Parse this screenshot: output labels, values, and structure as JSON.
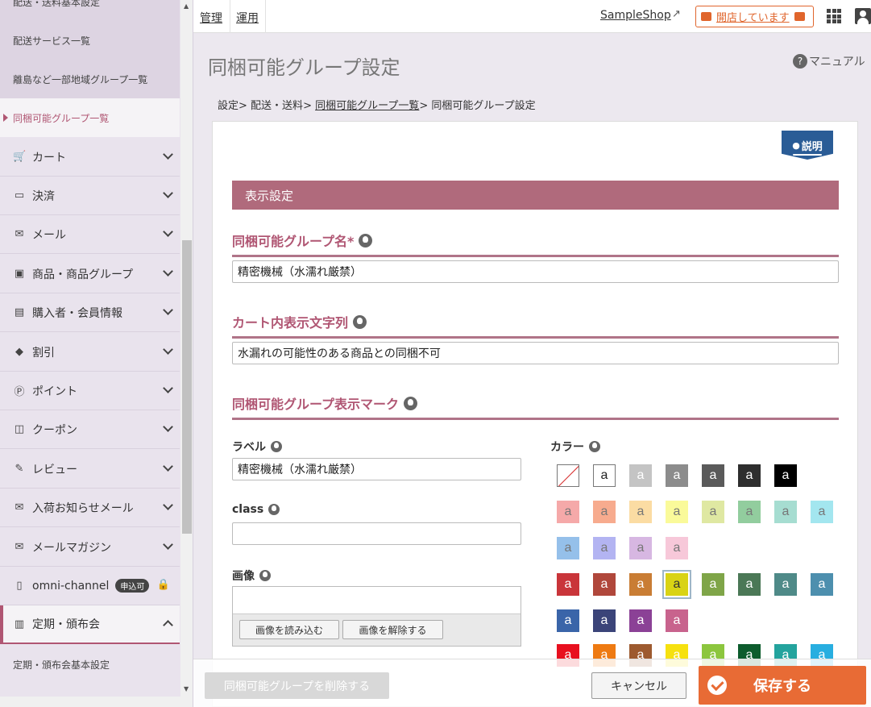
{
  "sidebar": {
    "sub_items_top": [
      {
        "label": "配送・送料基本設定"
      },
      {
        "label": "配送サービス一覧"
      },
      {
        "label": "離島など一部地域グループ一覧"
      },
      {
        "label": "同梱可能グループ一覧",
        "active": true
      }
    ],
    "menu": [
      {
        "label": "カート",
        "icon": "cart-icon"
      },
      {
        "label": "決済",
        "icon": "credit-card-icon"
      },
      {
        "label": "メール",
        "icon": "mail-icon"
      },
      {
        "label": "商品・商品グループ",
        "icon": "product-bag-icon"
      },
      {
        "label": "購入者・会員情報",
        "icon": "id-card-icon"
      },
      {
        "label": "割引",
        "icon": "tag-icon"
      },
      {
        "label": "ポイント",
        "icon": "point-icon"
      },
      {
        "label": "クーポン",
        "icon": "coupon-icon"
      },
      {
        "label": "レビュー",
        "icon": "review-icon"
      },
      {
        "label": "入荷お知らせメール",
        "icon": "mail-icon"
      },
      {
        "label": "メールマガジン",
        "icon": "envelope-icon"
      },
      {
        "label": "omni-channel",
        "icon": "mobile-icon",
        "badge": "申込可",
        "locked": true
      },
      {
        "label": "定期・頒布会",
        "icon": "calendar-icon",
        "open": true
      }
    ],
    "sub_items_bottom": [
      {
        "label": "定期・頒布会基本設定"
      }
    ]
  },
  "topbar": {
    "nav": [
      "管理",
      "運用"
    ],
    "shop_name": "SampleShop",
    "open_status": "開店しています"
  },
  "page": {
    "title": "同梱可能グループ設定",
    "manual_label": "マニュアル",
    "breadcrumb": {
      "b1": "設定",
      "b2": "配送・送料",
      "b3": "同梱可能グループ一覧",
      "b4": "同梱可能グループ設定"
    }
  },
  "form": {
    "explain_label": "説明",
    "section_title": "表示設定",
    "group_name_title": "同梱可能グループ名*",
    "group_name_value": "精密機械（水濡れ厳禁）",
    "cart_text_title": "カート内表示文字列",
    "cart_text_value": "水漏れの可能性のある商品との同梱不可",
    "mark_title": "同梱可能グループ表示マーク",
    "label_title": "ラベル",
    "label_value": "精密機械（水濡れ厳禁）",
    "class_title": "class",
    "class_value": "",
    "image_title": "画像",
    "load_image_btn": "画像を読み込む",
    "clear_image_btn": "画像を解除する",
    "color_title": "カラー",
    "swatch_letter": "a"
  },
  "swatch_rows": [
    [
      "none",
      "#ffffff",
      "#c4c4c4",
      "#8c8c8c",
      "#5a5a5a",
      "#2e2e2e",
      "#000000"
    ],
    [
      "#f5a9a9",
      "#f7ab8e",
      "#fbdca3",
      "#fafa9a",
      "#dfe8a2",
      "#92cd9e",
      "#a6ddd1",
      "#a3e6ef"
    ],
    [
      "#95c0ea",
      "#b3b4f2",
      "#d7b7e2",
      "#f7c8d9"
    ],
    [
      "#c9353a",
      "#b0473b",
      "#c97d34",
      "#d9d314",
      "#7fa548",
      "#4b7856",
      "#4f8a88",
      "#4d8fae"
    ],
    [
      "#3a65a9",
      "#3b4479",
      "#8b4196",
      "#c8638d"
    ],
    [
      "#e8101f",
      "#ee7a12",
      "#9d5a2f",
      "#f6e10f",
      "#8cc63e",
      "#0d5c2d",
      "#23a39d",
      "#28aee0"
    ]
  ],
  "swatch_selected": {
    "row": 3,
    "col": 3
  },
  "footer": {
    "delete_label": "同梱可能グループを削除する",
    "cancel_label": "キャンセル",
    "save_label": "保存する"
  }
}
